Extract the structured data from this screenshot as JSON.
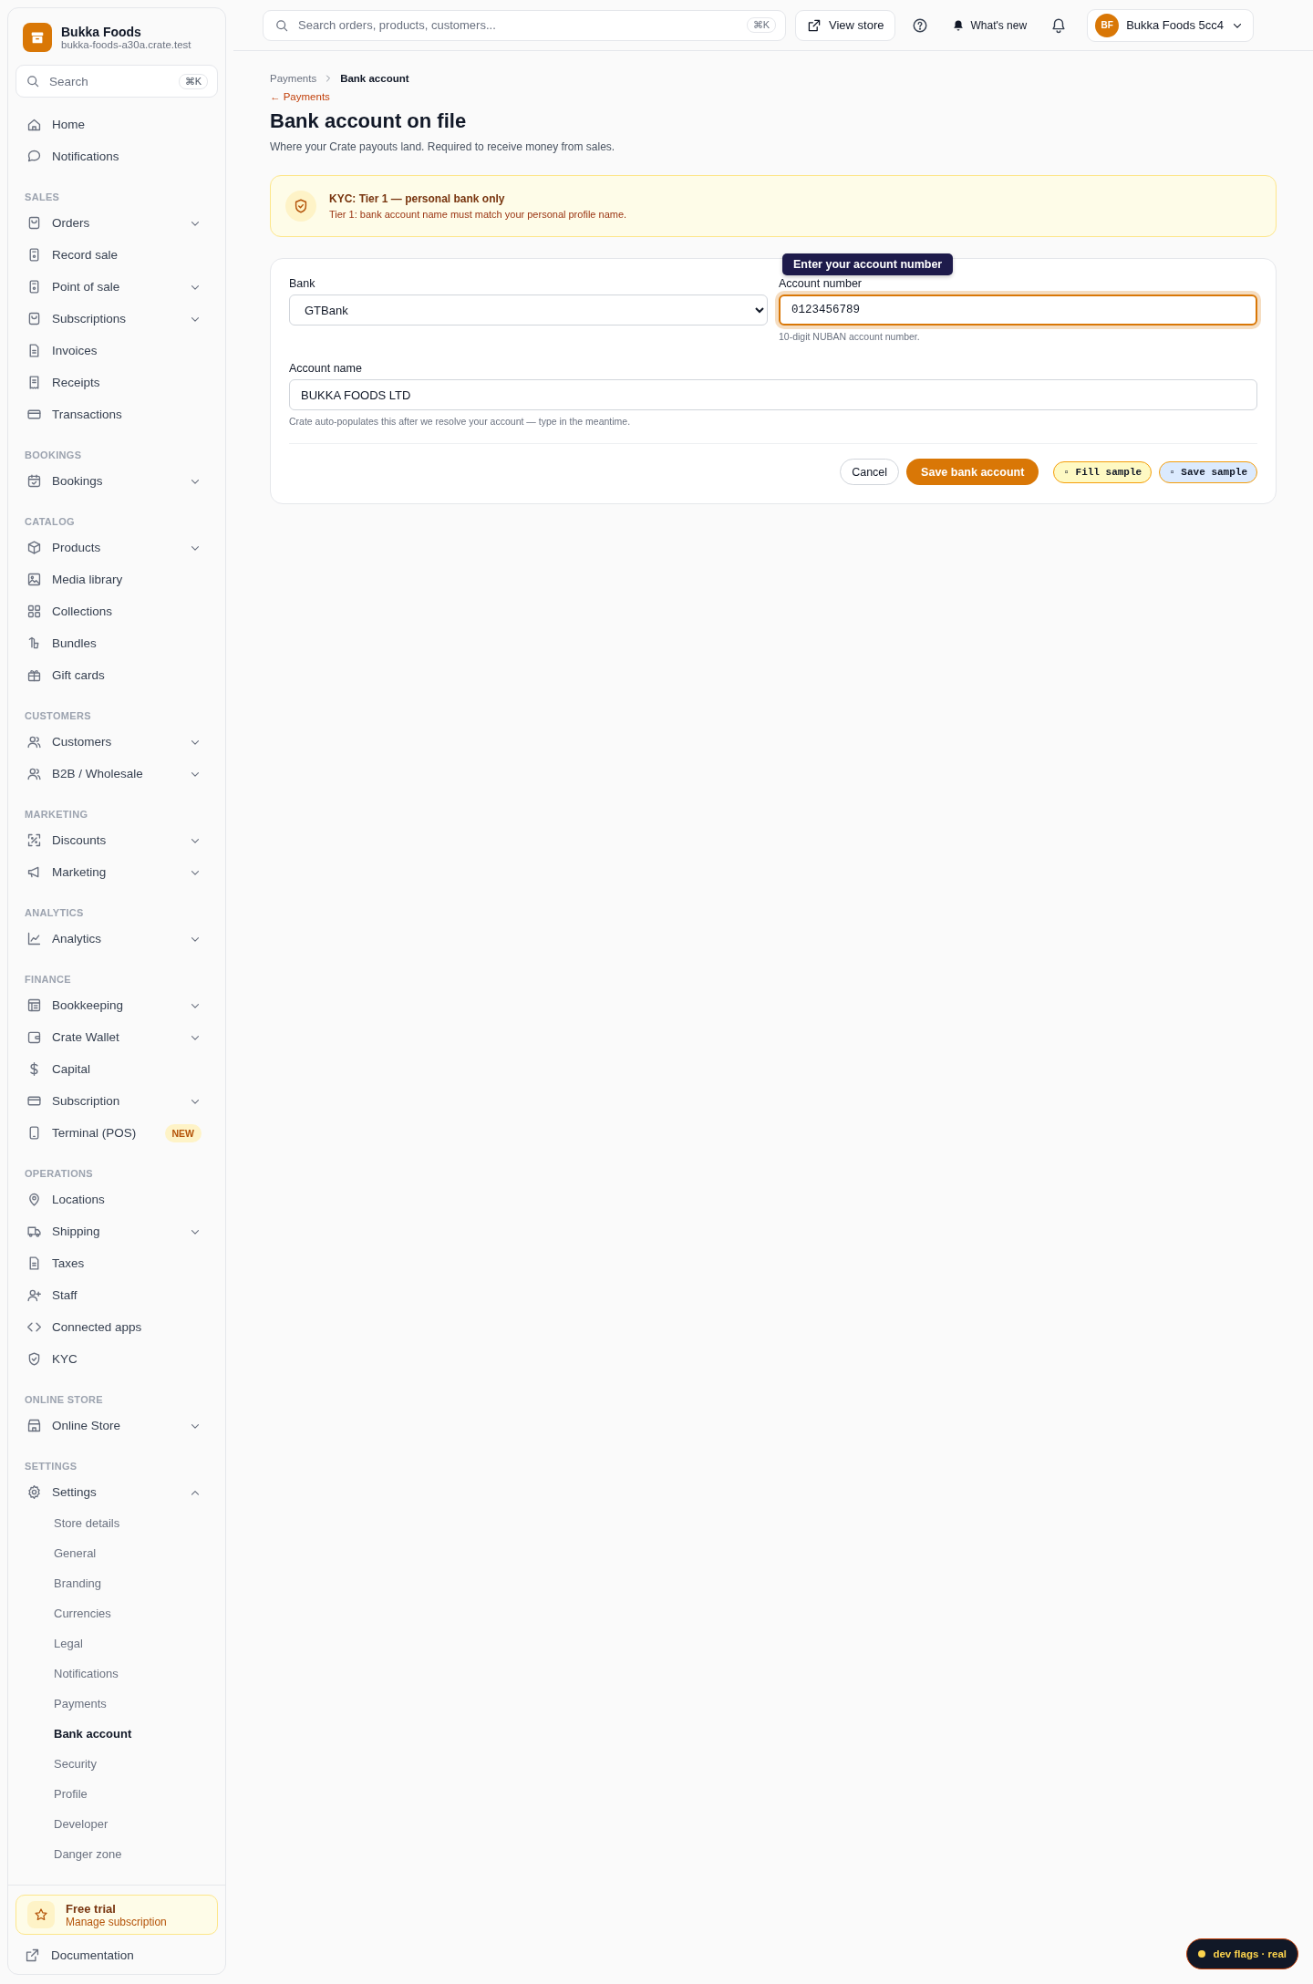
{
  "sidebar": {
    "brand": {
      "name": "Bukka Foods",
      "domain": "bukka-foods-a30a.crate.test"
    },
    "search": {
      "placeholder": "Search",
      "shortcut": "⌘K"
    },
    "sections": [
      {
        "items": [
          {
            "label": "Home",
            "expandable": false
          },
          {
            "label": "Notifications",
            "expandable": false
          }
        ]
      },
      {
        "heading": "SALES",
        "items": [
          {
            "label": "Orders",
            "expandable": true
          },
          {
            "label": "Record sale",
            "expandable": false
          },
          {
            "label": "Point of sale",
            "expandable": true
          },
          {
            "label": "Subscriptions",
            "expandable": true
          },
          {
            "label": "Invoices",
            "expandable": false
          },
          {
            "label": "Receipts",
            "expandable": false
          },
          {
            "label": "Transactions",
            "expandable": false
          }
        ]
      },
      {
        "heading": "BOOKINGS",
        "items": [
          {
            "label": "Bookings",
            "expandable": true
          }
        ]
      },
      {
        "heading": "CATALOG",
        "items": [
          {
            "label": "Products",
            "expandable": true
          },
          {
            "label": "Media library",
            "expandable": false
          },
          {
            "label": "Collections",
            "expandable": false
          },
          {
            "label": "Bundles",
            "expandable": false
          },
          {
            "label": "Gift cards",
            "expandable": false
          }
        ]
      },
      {
        "heading": "CUSTOMERS",
        "items": [
          {
            "label": "Customers",
            "expandable": true
          },
          {
            "label": "B2B / Wholesale",
            "expandable": true
          }
        ]
      },
      {
        "heading": "MARKETING",
        "items": [
          {
            "label": "Discounts",
            "expandable": true
          },
          {
            "label": "Marketing",
            "expandable": true
          }
        ]
      },
      {
        "heading": "ANALYTICS",
        "items": [
          {
            "label": "Analytics",
            "expandable": true
          }
        ]
      },
      {
        "heading": "FINANCE",
        "items": [
          {
            "label": "Bookkeeping",
            "expandable": true
          },
          {
            "label": "Crate Wallet",
            "expandable": true
          },
          {
            "label": "Capital",
            "expandable": false
          },
          {
            "label": "Subscription",
            "expandable": true
          },
          {
            "label": "Terminal (POS)",
            "expandable": false,
            "badge": "NEW"
          }
        ]
      },
      {
        "heading": "OPERATIONS",
        "items": [
          {
            "label": "Locations",
            "expandable": false
          },
          {
            "label": "Shipping",
            "expandable": true
          },
          {
            "label": "Taxes",
            "expandable": false
          },
          {
            "label": "Staff",
            "expandable": false
          },
          {
            "label": "Connected apps",
            "expandable": false
          },
          {
            "label": "KYC",
            "expandable": false
          }
        ]
      },
      {
        "heading": "ONLINE STORE",
        "items": [
          {
            "label": "Online Store",
            "expandable": true
          }
        ]
      },
      {
        "heading": "SETTINGS",
        "items": [
          {
            "label": "Settings",
            "expandable": true,
            "expanded": true,
            "children": [
              {
                "label": "Store details",
                "selected": false
              },
              {
                "label": "General",
                "selected": false
              },
              {
                "label": "Branding",
                "selected": false
              },
              {
                "label": "Currencies",
                "selected": false
              },
              {
                "label": "Legal",
                "selected": false
              },
              {
                "label": "Notifications",
                "selected": false
              },
              {
                "label": "Payments",
                "selected": false
              },
              {
                "label": "Bank account",
                "selected": true
              },
              {
                "label": "Security",
                "selected": false
              },
              {
                "label": "Profile",
                "selected": false
              },
              {
                "label": "Developer",
                "selected": false
              },
              {
                "label": "Danger zone",
                "selected": false
              }
            ]
          }
        ]
      }
    ],
    "trial": {
      "title": "Free trial",
      "link": "Manage subscription"
    },
    "documentation": "Documentation"
  },
  "topbar": {
    "search": {
      "placeholder": "Search orders, products, customers...",
      "shortcut": "⌘K"
    },
    "view_store": "View store",
    "whats_new": "What's new",
    "account": {
      "initials": "BF",
      "name": "Bukka Foods 5cc4"
    }
  },
  "breadcrumb": [
    "Payments",
    "Bank account"
  ],
  "back_link": "← Payments",
  "title": "Bank account on file",
  "subtitle": "Where your Crate payouts land. Required to receive money from sales.",
  "notice": {
    "title": "KYC: Tier 1 — personal bank only",
    "text": "Tier 1: bank account name must match your personal profile name."
  },
  "form": {
    "bank": {
      "label": "Bank",
      "value": "GTBank"
    },
    "account_number": {
      "label": "Account number",
      "value": "0123456789",
      "hint": "10-digit NUBAN account number.",
      "focused": true,
      "tooltip": "Enter your account number"
    },
    "account_name": {
      "label": "Account name",
      "value": "BUKKA FOODS LTD",
      "hint": "Crate auto-populates this after we resolve your account — type in the meantime."
    },
    "buttons": [
      {
        "label": "Cancel",
        "kind": "secondary"
      },
      {
        "label": "Save bank account",
        "kind": "primary"
      },
      {
        "label": "▫ Fill sample",
        "kind": "dev-yellow"
      },
      {
        "label": "▫ Save sample",
        "kind": "dev-blue"
      }
    ]
  },
  "dev_flags": "dev flags · real"
}
